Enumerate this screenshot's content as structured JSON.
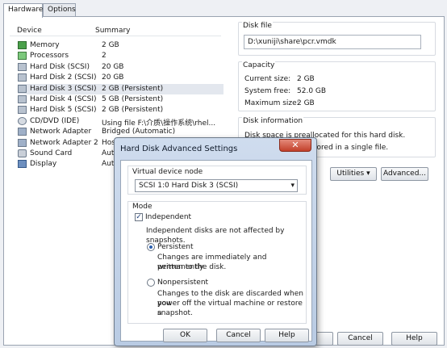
{
  "tabs": [
    "Hardware",
    "Options"
  ],
  "device_list": {
    "columns": [
      "Device",
      "Summary"
    ],
    "rows": [
      {
        "icon": "memory-icon",
        "name": "Memory",
        "summary": "2 GB"
      },
      {
        "icon": "processor-icon",
        "name": "Processors",
        "summary": "2"
      },
      {
        "icon": "hard-disk-icon",
        "name": "Hard Disk (SCSI)",
        "summary": "20 GB"
      },
      {
        "icon": "hard-disk-icon",
        "name": "Hard Disk 2 (SCSI)",
        "summary": "20 GB"
      },
      {
        "icon": "hard-disk-icon",
        "name": "Hard Disk 3 (SCSI)",
        "summary": "2 GB (Persistent)"
      },
      {
        "icon": "hard-disk-icon",
        "name": "Hard Disk 4 (SCSI)",
        "summary": "5 GB (Persistent)"
      },
      {
        "icon": "hard-disk-icon",
        "name": "Hard Disk 5 (SCSI)",
        "summary": "2 GB (Persistent)"
      },
      {
        "icon": "cd-dvd-icon",
        "name": "CD/DVD (IDE)",
        "summary": "Using file F:\\介质\\操作系统\\rhel..."
      },
      {
        "icon": "network-adapter-icon",
        "name": "Network Adapter",
        "summary": "Bridged (Automatic)"
      },
      {
        "icon": "network-adapter-icon",
        "name": "Network Adapter 2",
        "summary": "Host-"
      },
      {
        "icon": "sound-card-icon",
        "name": "Sound Card",
        "summary": "Auto c"
      },
      {
        "icon": "display-icon",
        "name": "Display",
        "summary": "Auto c"
      }
    ],
    "selected_index": 4
  },
  "disk_file": {
    "title": "Disk file",
    "path": "D:\\xuniji\\share\\pcr.vmdk"
  },
  "capacity": {
    "title": "Capacity",
    "current_label": "Current size:",
    "current_value": "2 GB",
    "free_label": "System free:",
    "free_value": "52.0 GB",
    "max_label": "Maximum size:",
    "max_value": "2 GB"
  },
  "disk_info": {
    "title": "Disk information",
    "line1": "Disk space is preallocated for this hard disk.",
    "line2": "tored in a single file."
  },
  "buttons": {
    "utilities": "Utilities",
    "advanced": "Advanced...",
    "cancel": "Cancel",
    "help": "Help"
  },
  "dialog": {
    "title": "Hard Disk Advanced Settings",
    "close": "✕",
    "vdn_title": "Virtual device node",
    "vdn_value": "SCSI  1:0   Hard Disk 3 (SCSI)",
    "mode_title": "Mode",
    "independent_label": "Independent",
    "independent_desc": "Independent disks are not affected by snapshots.",
    "persistent_label": "Persistent",
    "persistent_desc1": "Changes are immediately and permanently",
    "persistent_desc2": "written to the disk.",
    "nonpersistent_label": "Nonpersistent",
    "nonpersistent_desc1": "Changes to the disk are discarded when you",
    "nonpersistent_desc2": "power off the virtual machine or restore a",
    "nonpersistent_desc3": "snapshot.",
    "ok": "OK",
    "cancel": "Cancel",
    "help": "Help"
  }
}
